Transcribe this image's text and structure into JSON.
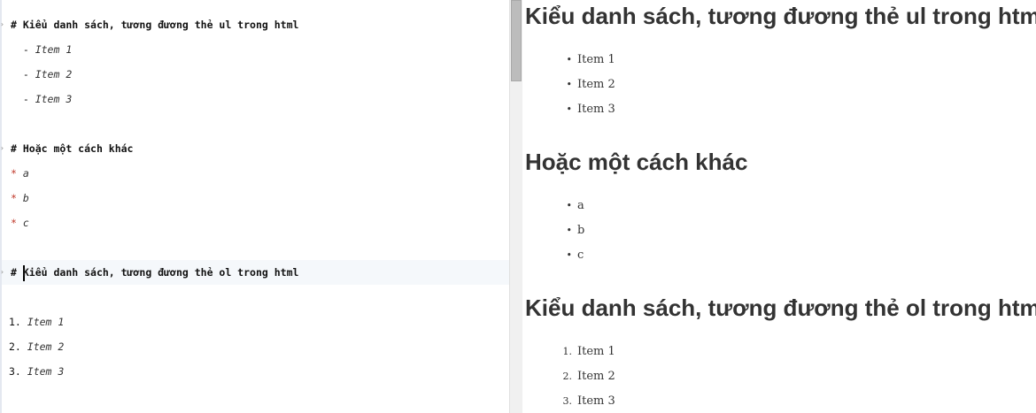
{
  "editor": {
    "lines": [
      {
        "marker": "# ",
        "text": "Kiểu danh sách, tương đương thẻ ul trong html"
      },
      {
        "marker": "  - ",
        "text": "Item 1"
      },
      {
        "marker": "  - ",
        "text": "Item 2"
      },
      {
        "marker": "  - ",
        "text": "Item 3"
      },
      {
        "marker": "# ",
        "text": "Hoặc một cách khác"
      },
      {
        "marker": "* ",
        "text": "a"
      },
      {
        "marker": "* ",
        "text": "b"
      },
      {
        "marker": "* ",
        "text": "c"
      },
      {
        "marker": "# ",
        "text": "Kiểu danh sách, tương đương thẻ ol trong html"
      },
      {
        "marker": "1. ",
        "text": "Item 1"
      },
      {
        "marker": "2. ",
        "text": "Item 2"
      },
      {
        "marker": "3. ",
        "text": "Item 3"
      }
    ]
  },
  "preview": {
    "heading1": "Kiểu danh sách, tương đương thẻ ul trong html",
    "ul1": [
      "Item 1",
      "Item 2",
      "Item 3"
    ],
    "heading2": "Hoặc một cách khác",
    "ul2": [
      "a",
      "b",
      "c"
    ],
    "heading3": "Kiểu danh sách, tương đương thẻ ol trong html",
    "ol": [
      "Item 1",
      "Item 2",
      "Item 3"
    ],
    "bullet": "•",
    "ol_markers": [
      "1.",
      "2.",
      "3."
    ]
  },
  "colors": {
    "list_marker": "#c0392b",
    "heading": "#333333",
    "active_line": "#f5f8fb"
  }
}
